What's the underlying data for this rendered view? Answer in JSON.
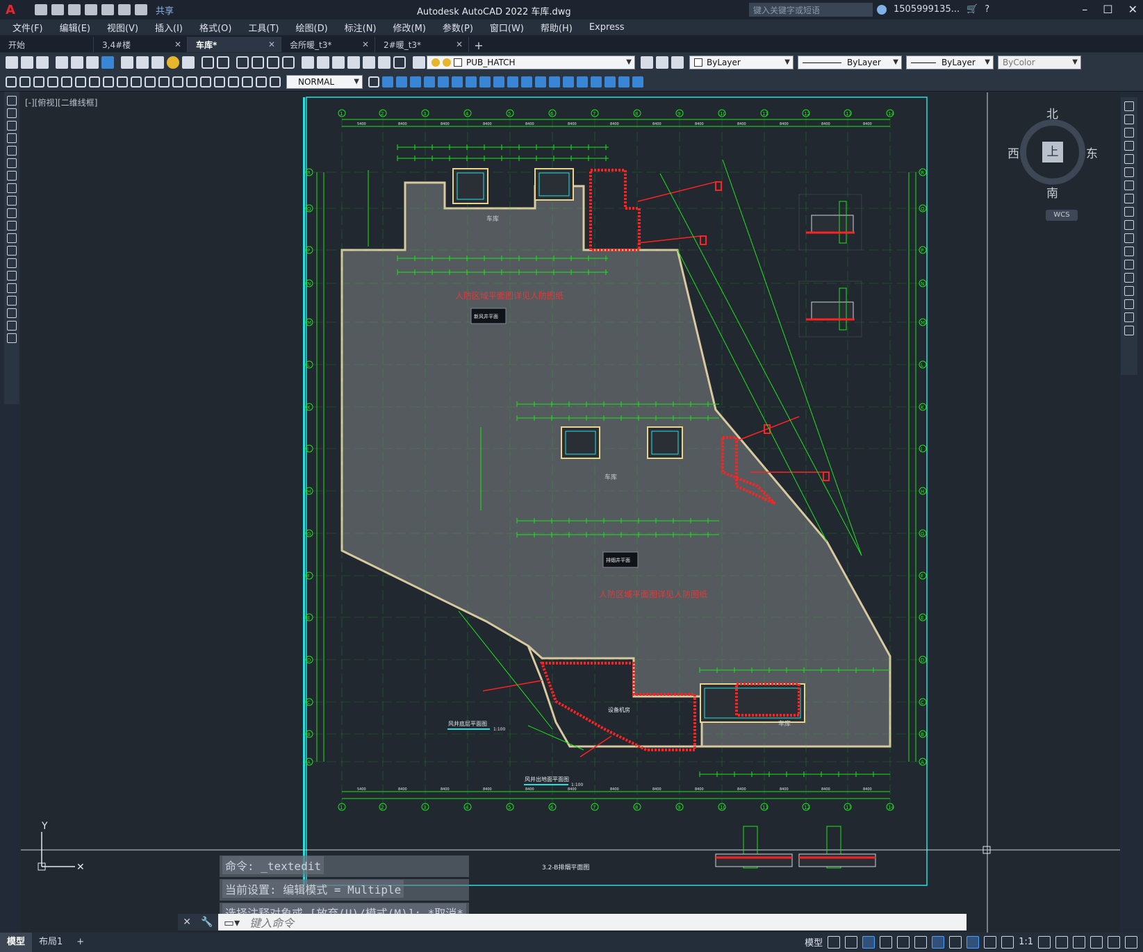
{
  "window": {
    "title": "Autodesk AutoCAD 2022    车库.dwg",
    "share_label": "共享",
    "search_placeholder": "键入关键字或短语",
    "user": "1505999135...",
    "logo": "A"
  },
  "menu": [
    "文件(F)",
    "编辑(E)",
    "视图(V)",
    "插入(I)",
    "格式(O)",
    "工具(T)",
    "绘图(D)",
    "标注(N)",
    "修改(M)",
    "参数(P)",
    "窗口(W)",
    "帮助(H)",
    "Express"
  ],
  "tabs": [
    {
      "label": "开始",
      "closable": false,
      "active": false
    },
    {
      "label": "3,4#楼",
      "closable": true,
      "active": false
    },
    {
      "label": "车库*",
      "closable": true,
      "active": true
    },
    {
      "label": "会所暖_t3*",
      "closable": true,
      "active": false
    },
    {
      "label": "2#暖_t3*",
      "closable": true,
      "active": false
    }
  ],
  "toolbar": {
    "layer": "PUB_HATCH",
    "color": "ByLayer",
    "linetype": "ByLayer",
    "lineweight": "ByLayer",
    "plotstyle": "ByColor",
    "dimstyle": "NORMAL"
  },
  "viewport_label": "[-][俯视][二维线框]",
  "viewcube": {
    "north": "北",
    "south": "南",
    "east": "东",
    "west": "西",
    "top": "上",
    "wcs": "WCS"
  },
  "drawing": {
    "grid_cols": [
      "1",
      "2",
      "3",
      "4",
      "5",
      "6",
      "7",
      "8",
      "9",
      "10",
      "11",
      "12",
      "13",
      "14"
    ],
    "grid_rows": [
      "R",
      "Q",
      "P",
      "N",
      "M",
      "L",
      "K",
      "J",
      "H",
      "G",
      "F",
      "E",
      "D",
      "C",
      "B",
      "A"
    ],
    "labels": {
      "note1": "人防区域平面图详见人防图纸",
      "note2": "人防区域平面图详见人防图纸",
      "room1": "车库",
      "room2": "车库",
      "room3": "车库",
      "tag1": "新风井平面",
      "tag2": "排烟井平面",
      "tag3": "设备机房",
      "title1": "风井底层平面图",
      "title2": "风井出地面平面图",
      "scale": "1:100",
      "bottom_title": "3.2-B排烟平面图"
    },
    "dims": [
      "5400",
      "8400",
      "8400",
      "8400",
      "8400",
      "8400",
      "8400",
      "8400",
      "8400",
      "8400",
      "8400",
      "8400",
      "8400"
    ]
  },
  "command": {
    "history": [
      "命令: _textedit",
      "当前设置: 编辑模式 = Multiple",
      "选择注释对象或 [放弃(U)/模式(M)]: *取消*"
    ],
    "placeholder": "键入命令"
  },
  "status": {
    "layouts": [
      "模型",
      "布局1"
    ],
    "model_label": "模型",
    "scale": "1:1"
  },
  "colors": {
    "green": "#19e619",
    "red": "#ff2222",
    "cyan": "#28e0e0",
    "hatch": "#555a5e",
    "boundary": "#d8c9a0"
  }
}
